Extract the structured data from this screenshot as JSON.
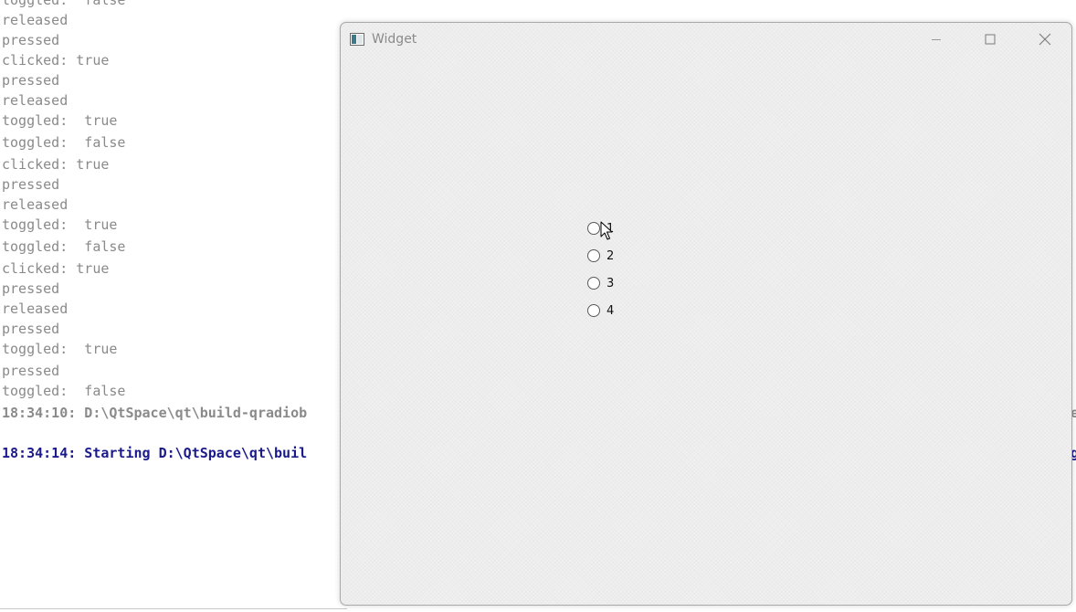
{
  "console": {
    "lines": [
      "toggled:  false",
      "released",
      "pressed",
      "clicked: true",
      "pressed",
      "released",
      "toggled:  true",
      "toggled:  false",
      "clicked: true",
      "pressed",
      "released",
      "toggled:  true",
      "toggled:  false",
      "clicked: true",
      "pressed",
      "released",
      "pressed",
      "toggled:  true",
      "pressed",
      "toggled:  false"
    ],
    "status_line_1": "18:34:10: D:\\QtSpace\\qt\\build-qradiob",
    "status_line_1_tail": "e",
    "status_line_2": "18:34:14: Starting D:\\QtSpace\\qt\\buil",
    "status_line_2_tail": "g"
  },
  "window": {
    "title": "Widget",
    "icons": {
      "app": "qt-widget-app-icon",
      "minimize": "minimize-icon",
      "maximize": "maximize-icon",
      "close": "close-icon"
    }
  },
  "radios": [
    {
      "label": "1",
      "checked": false
    },
    {
      "label": "2",
      "checked": false
    },
    {
      "label": "3",
      "checked": false
    },
    {
      "label": "4",
      "checked": false
    }
  ],
  "colors": {
    "console_text": "#8a8a8a",
    "console_status_blue": "#1a1a8c",
    "window_bg": "#f0f0f0"
  }
}
